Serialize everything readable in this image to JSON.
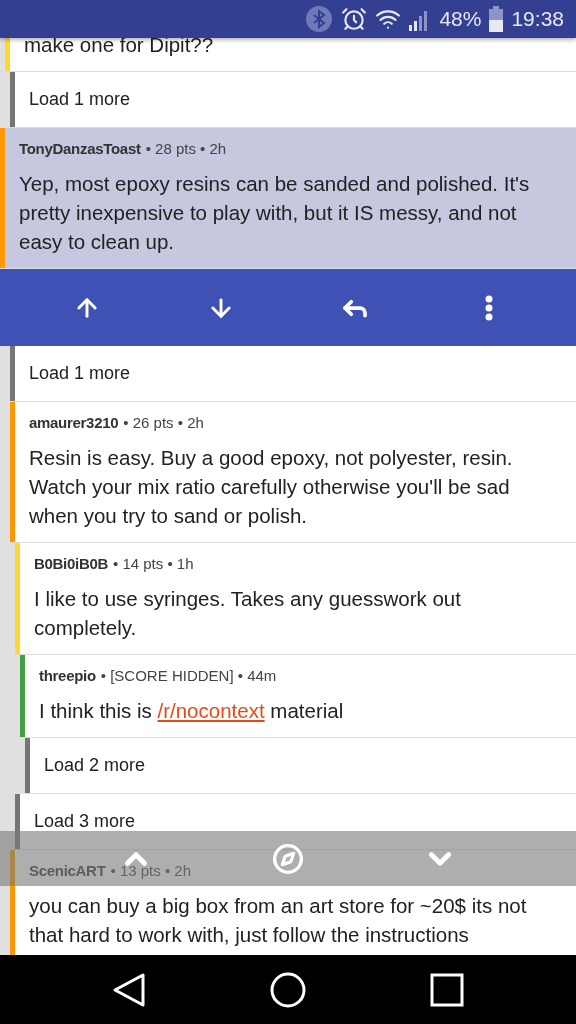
{
  "status_bar": {
    "battery": "48%",
    "time": "19:38"
  },
  "comments": [
    {
      "kind": "comment",
      "color": "#fdd835",
      "selected": false,
      "body": [
        {
          "kind": "text",
          "text": "make one for Dipit??"
        }
      ],
      "children": [
        {
          "kind": "load_more",
          "label": "Load 1 more"
        }
      ]
    },
    {
      "kind": "comment",
      "color": "#ff9800",
      "selected": true,
      "author": "TonyDanzasToast",
      "meta": "• 28 pts • 2h",
      "body": [
        {
          "kind": "text",
          "text": "Yep, most epoxy resins can be sanded and polished. It's pretty inexpensive to play with, but it IS messy, and not easy to clean up."
        }
      ],
      "children": [
        {
          "kind": "load_more",
          "label": "Load 1 more"
        },
        {
          "kind": "comment",
          "color": "#ff9800",
          "selected": false,
          "author": "amaurer3210",
          "meta": "• 26 pts • 2h",
          "body": [
            {
              "kind": "text",
              "text": "Resin is easy. Buy a good epoxy, not polyester, resin. Watch your mix ratio carefully otherwise you'll be sad when you try to sand or polish."
            }
          ],
          "children": [
            {
              "kind": "comment",
              "color": "#fdd835",
              "selected": false,
              "author": "B0Bi0iB0B",
              "meta": "• 14 pts • 1h",
              "body": [
                {
                  "kind": "text",
                  "text": "I like to use syringes. Takes any guesswork out completely."
                }
              ],
              "children": [
                {
                  "kind": "comment",
                  "color": "#43a047",
                  "selected": false,
                  "author": "threepio",
                  "meta": "• [SCORE HIDDEN] • 44m",
                  "body": [
                    {
                      "kind": "text",
                      "text": "I think this is "
                    },
                    {
                      "kind": "link",
                      "text": "/r/nocontext"
                    },
                    {
                      "kind": "text",
                      "text": " material"
                    }
                  ],
                  "children": [
                    {
                      "kind": "load_more",
                      "label": "Load 2 more"
                    }
                  ]
                }
              ]
            },
            {
              "kind": "load_more",
              "label": "Load 3 more"
            }
          ]
        },
        {
          "kind": "comment",
          "color": "#ff9800",
          "selected": false,
          "author": "ScenicART",
          "meta": "• 13 pts • 2h",
          "body": [
            {
              "kind": "text",
              "text": "you can buy a big box from an art store for ~20$ its not that hard to work with, just follow the instructions"
            }
          ]
        }
      ]
    }
  ]
}
